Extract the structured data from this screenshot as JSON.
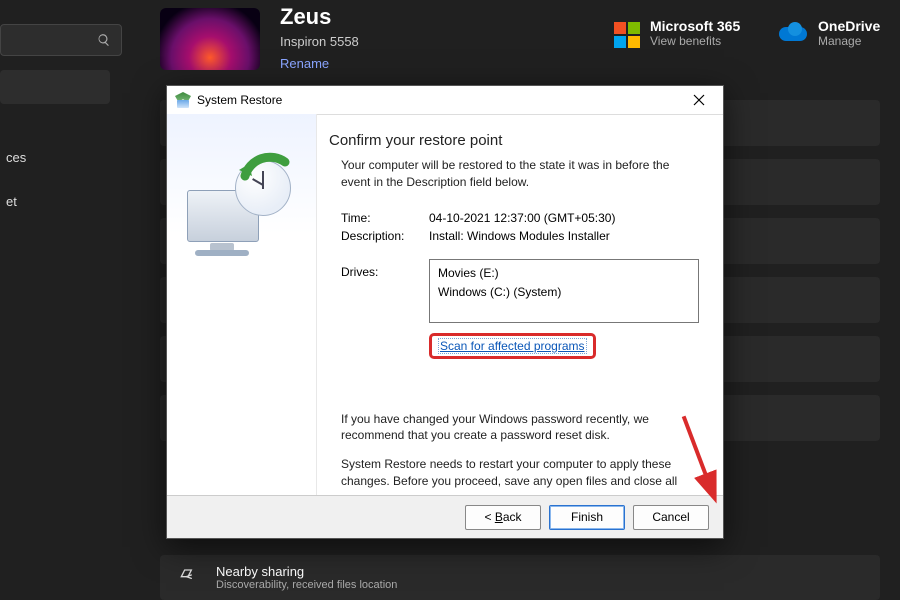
{
  "sidebar": {
    "search_placeholder": "",
    "items": [
      "ces",
      "et"
    ]
  },
  "profile": {
    "name": "Zeus",
    "model": "Inspiron 5558",
    "rename_label": "Rename"
  },
  "tiles": {
    "ms365": {
      "label": "Microsoft 365",
      "sub": "View benefits"
    },
    "onedrive": {
      "label": "OneDrive",
      "sub": "Manage"
    }
  },
  "nearby": {
    "title": "Nearby sharing",
    "sub": "Discoverability, received files location"
  },
  "dialog": {
    "title": "System Restore",
    "heading": "Confirm your restore point",
    "intro": "Your computer will be restored to the state it was in before the event in the Description field below.",
    "time_label": "Time:",
    "time_value": "04-10-2021 12:37:00 (GMT+05:30)",
    "desc_label": "Description:",
    "desc_value": "Install: Windows Modules Installer",
    "drives_label": "Drives:",
    "drives": [
      "Movies (E:)",
      "Windows (C:) (System)"
    ],
    "scan_link": "Scan for affected programs",
    "note1": "If you have changed your Windows password recently, we recommend that you create a password reset disk.",
    "note2": "System Restore needs to restart your computer to apply these changes. Before you proceed, save any open files and close all programs.",
    "buttons": {
      "back": "Back",
      "back_accel": "B",
      "finish": "Finish",
      "cancel": "Cancel"
    }
  }
}
